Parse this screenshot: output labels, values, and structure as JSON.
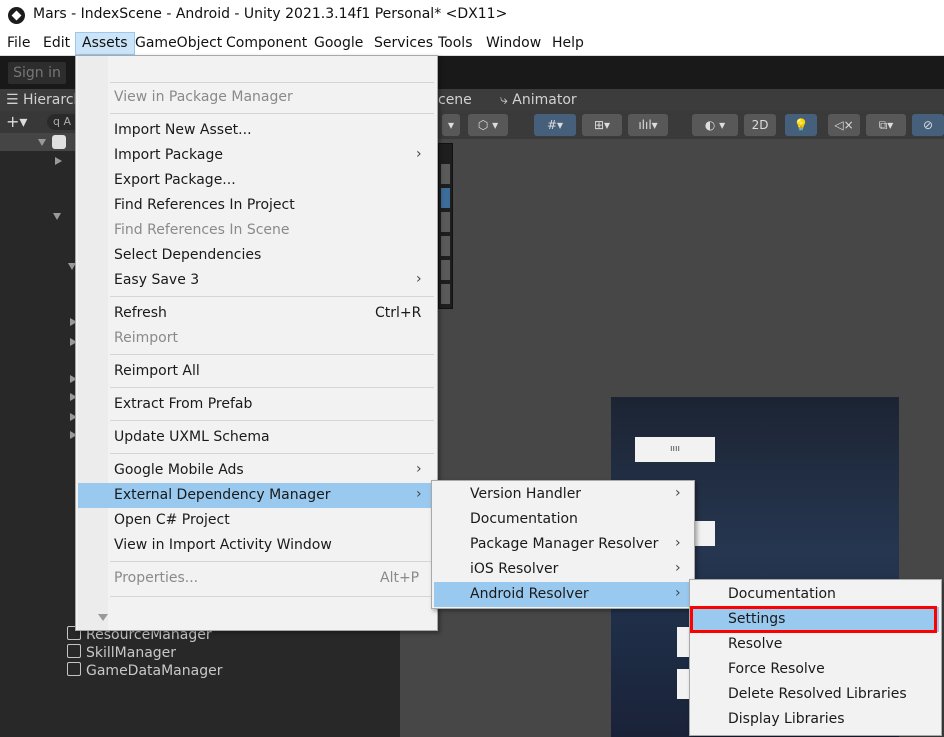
{
  "window": {
    "title": "Mars - IndexScene - Android - Unity 2021.3.14f1 Personal* <DX11>"
  },
  "menubar": [
    "File",
    "Edit",
    "Assets",
    "GameObject",
    "Component",
    "Google",
    "Services",
    "Tools",
    "Window",
    "Help"
  ],
  "toolbar": {
    "sign_in": "Sign in"
  },
  "hierarchy": {
    "tab": "☰ Hierarch",
    "search_prefix": "q A",
    "items": [
      "ResourceManager",
      "SkillManager",
      "GameDataManager"
    ]
  },
  "scene": {
    "tabs": [
      "cene",
      "Animator"
    ],
    "mode_2d": "2D",
    "game_button_label": "ıııı"
  },
  "assets_menu": {
    "items": [
      {
        "label": "View in Package Manager",
        "disabled": true
      },
      {
        "label": "Import New Asset..."
      },
      {
        "label": "Import Package",
        "submenu": true
      },
      {
        "label": "Export Package..."
      },
      {
        "label": "Find References In Project"
      },
      {
        "label": "Find References In Scene",
        "disabled": true
      },
      {
        "label": "Select Dependencies"
      },
      {
        "label": "Easy Save 3",
        "submenu": true
      },
      {
        "label": "Refresh",
        "shortcut": "Ctrl+R"
      },
      {
        "label": "Reimport",
        "disabled": true
      },
      {
        "label": "Reimport All"
      },
      {
        "label": "Extract From Prefab"
      },
      {
        "label": "Update UXML Schema"
      },
      {
        "label": "Google Mobile Ads",
        "submenu": true
      },
      {
        "label": "External Dependency Manager",
        "submenu": true,
        "highlighted": true
      },
      {
        "label": "Open C# Project"
      },
      {
        "label": "View in Import Activity Window"
      },
      {
        "label": "Properties...",
        "shortcut": "Alt+P",
        "disabled": true
      }
    ]
  },
  "edm_submenu": {
    "items": [
      {
        "label": "Version Handler",
        "submenu": true
      },
      {
        "label": "Documentation"
      },
      {
        "label": "Package Manager Resolver",
        "submenu": true
      },
      {
        "label": "iOS Resolver",
        "submenu": true
      },
      {
        "label": "Android Resolver",
        "submenu": true,
        "highlighted": true
      }
    ]
  },
  "android_submenu": {
    "items": [
      {
        "label": "Documentation"
      },
      {
        "label": "Settings",
        "highlighted": true,
        "annotated": true
      },
      {
        "label": "Resolve"
      },
      {
        "label": "Force Resolve"
      },
      {
        "label": "Delete Resolved Libraries"
      },
      {
        "label": "Display Libraries"
      }
    ]
  },
  "colors": {
    "menu_highlight": "#99c9ef",
    "annotation": "#ff0000",
    "menu_bg": "#f2f2f2"
  }
}
